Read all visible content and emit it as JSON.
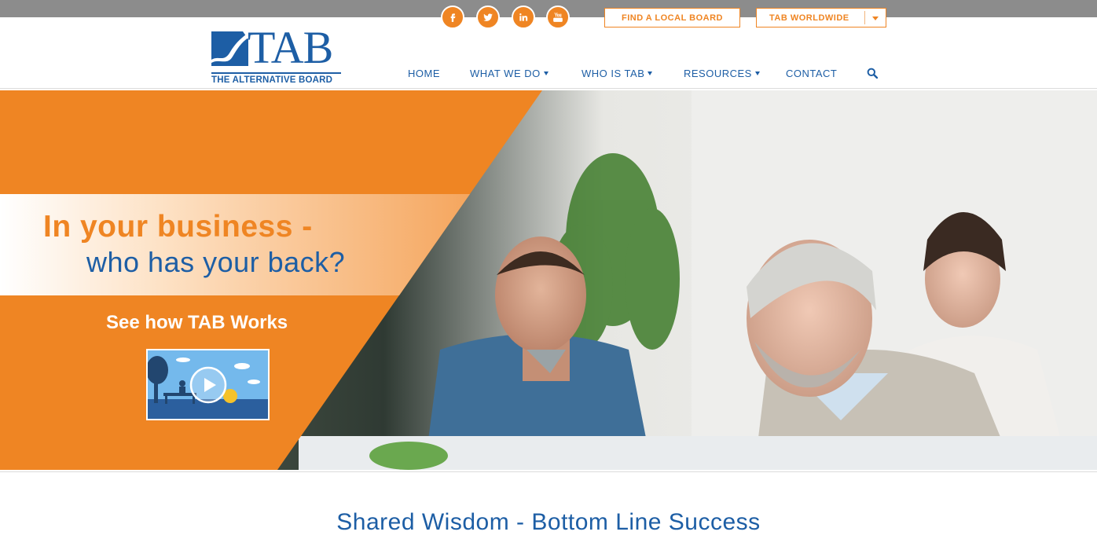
{
  "social": [
    {
      "name": "facebook-icon",
      "glyph": "f"
    },
    {
      "name": "twitter-icon",
      "glyph": "t"
    },
    {
      "name": "linkedin-icon",
      "glyph": "in"
    },
    {
      "name": "youtube-icon",
      "glyph": "You"
    }
  ],
  "top_buttons": {
    "find_local_board": "FIND A LOCAL BOARD",
    "tab_worldwide": "TAB WORLDWIDE"
  },
  "logo": {
    "wordmark": "TAB",
    "subtitle": "THE ALTERNATIVE BOARD"
  },
  "nav": {
    "home": "HOME",
    "what_we_do": "WHAT WE DO",
    "who_is_tab": "WHO IS TAB",
    "resources": "RESOURCES",
    "contact": "CONTACT"
  },
  "hero": {
    "headline_line1": "In your business -",
    "headline_line2": "who has your back?",
    "cta": "See how TAB Works"
  },
  "tagline": "Shared Wisdom - Bottom Line Success",
  "colors": {
    "orange": "#ef8523",
    "blue": "#1d5ea5",
    "topbar_gray": "#8c8c8c"
  }
}
